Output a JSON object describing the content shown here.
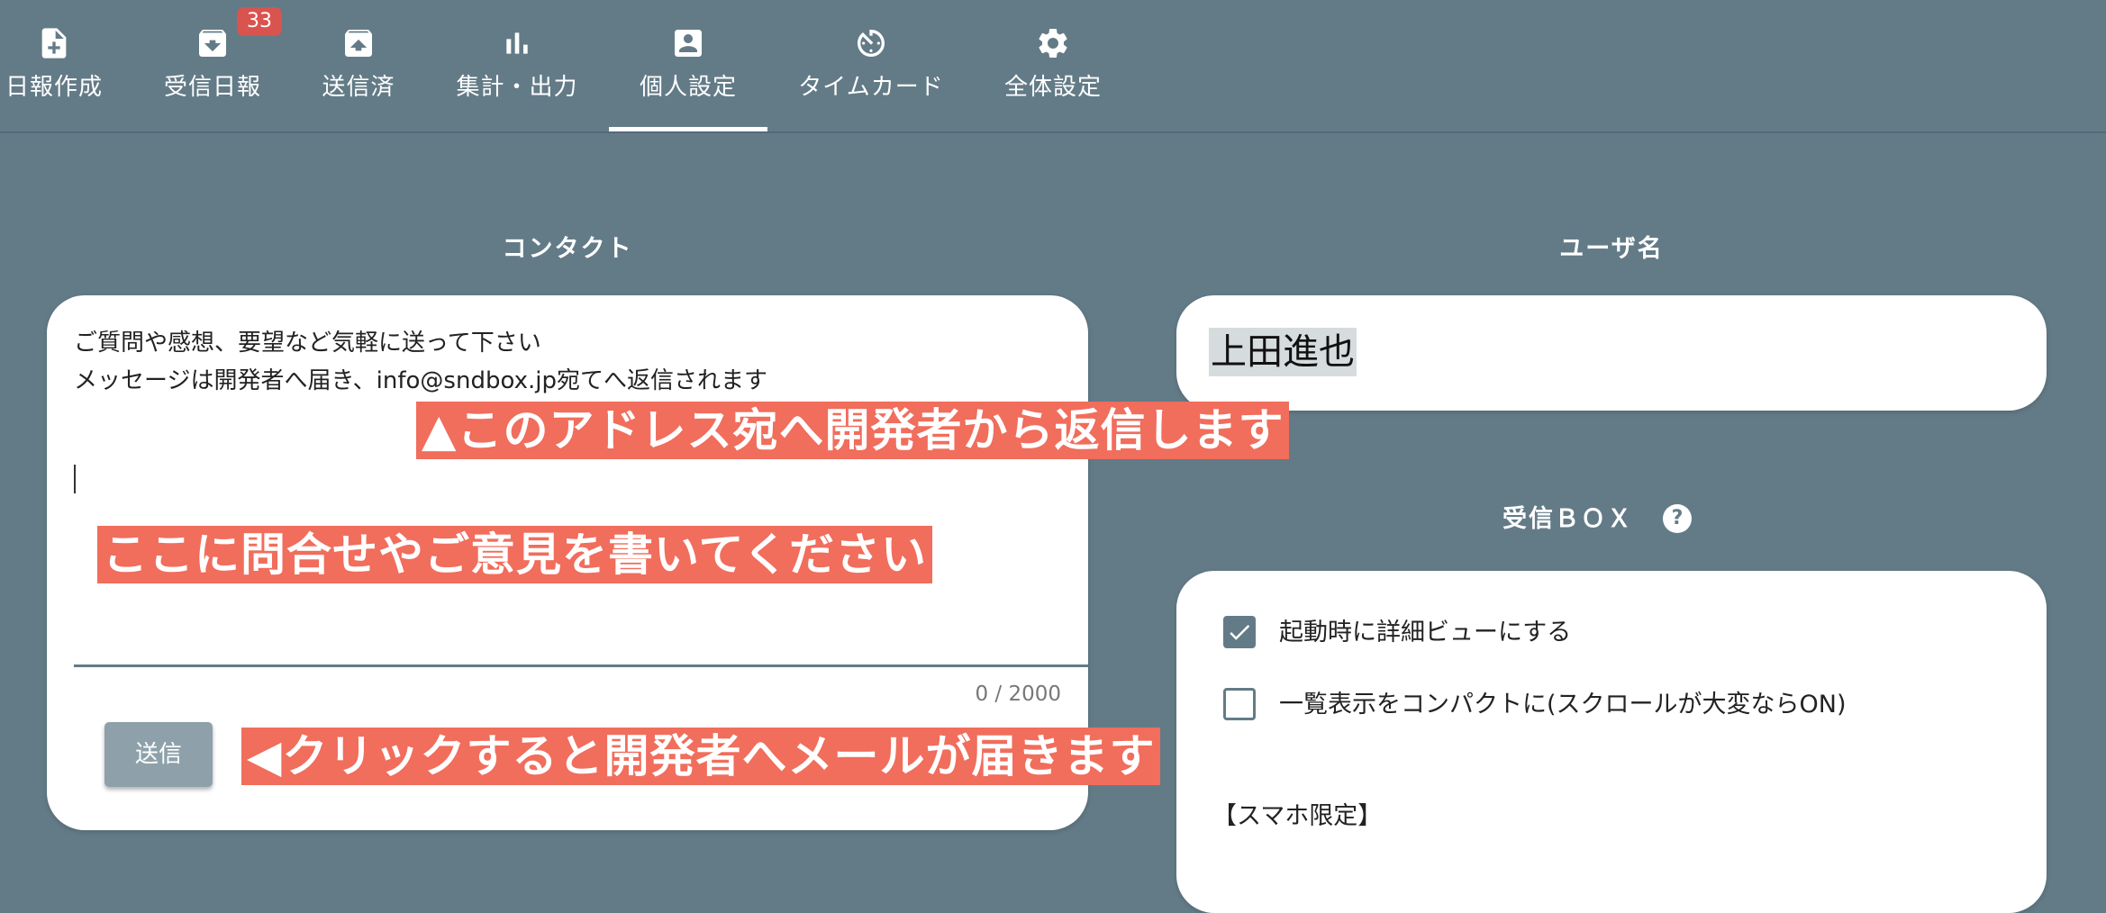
{
  "nav": {
    "tabs": [
      {
        "label": "日報作成",
        "icon": "new-report-icon"
      },
      {
        "label": "受信日報",
        "icon": "inbox-download-icon",
        "badge": "33"
      },
      {
        "label": "送信済",
        "icon": "outbox-upload-icon"
      },
      {
        "label": "集計・出力",
        "icon": "bar-chart-icon"
      },
      {
        "label": "個人設定",
        "icon": "account-box-icon",
        "active": true
      },
      {
        "label": "タイムカード",
        "icon": "timer-icon"
      },
      {
        "label": "全体設定",
        "icon": "gear-icon"
      }
    ]
  },
  "contact": {
    "title": "コンタクト",
    "intro_line1": "ご質問や感想、要望など気軽に送って下さい",
    "intro_line2": "メッセージは開発者へ届き、info@sndbox.jp宛てへ返信されます",
    "message_value": "",
    "counter": "0 / 2000",
    "send_label": "送信"
  },
  "username": {
    "title": "ユーザ名",
    "value": "上田進也"
  },
  "inbox": {
    "title": "受信ＢＯＸ",
    "help_icon": "?",
    "options": [
      {
        "label": "起動時に詳細ビューにする",
        "checked": true
      },
      {
        "label": "一覧表示をコンパクトに(スクロールが大変ならON)",
        "checked": false
      }
    ],
    "smartphone_label": "【スマホ限定】"
  },
  "annotations": {
    "address_note": "▲このアドレス宛へ開発者から返信します",
    "write_note": "ここに問合せやご意見を書いてください",
    "click_note": "◀クリックすると開発者へメールが届きます"
  },
  "colors": {
    "background": "#637b87",
    "annotation": "#f16d5c",
    "badge": "#d9534f",
    "button": "#8ea1ab"
  }
}
